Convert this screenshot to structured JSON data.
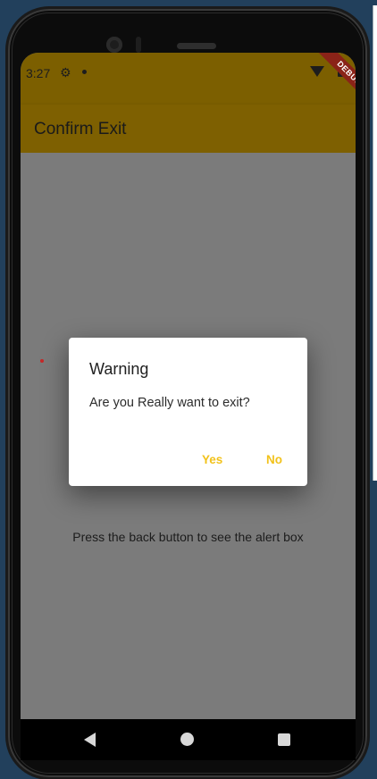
{
  "status_bar": {
    "time": "3:27",
    "debug_label": "DEBUG"
  },
  "app_bar": {
    "title": "Confirm Exit"
  },
  "body": {
    "text": "Press the back button to see the alert box"
  },
  "dialog": {
    "title": "Warning",
    "message": "Are you Really want to exit?",
    "yes_label": "Yes",
    "no_label": "No"
  },
  "colors": {
    "app_bar_accent": "#ffc107",
    "dialog_button": "#f2c21b",
    "background_desktop": "#22405c"
  }
}
